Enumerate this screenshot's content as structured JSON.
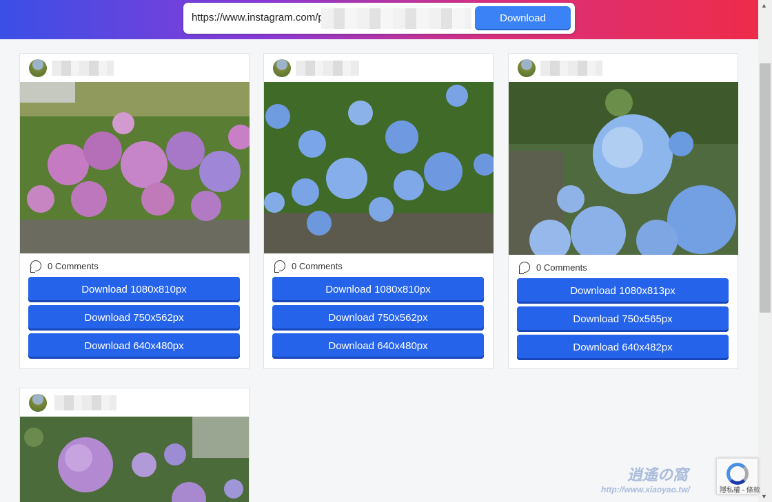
{
  "search": {
    "url_value": "https://www.instagram.com/p",
    "download_label": "Download"
  },
  "comments_label": "0 Comments",
  "cards": [
    {
      "downloads": [
        "Download 1080x810px",
        "Download 750x562px",
        "Download 640x480px"
      ]
    },
    {
      "downloads": [
        "Download 1080x810px",
        "Download 750x562px",
        "Download 640x480px"
      ]
    },
    {
      "downloads": [
        "Download 1080x813px",
        "Download 750x565px",
        "Download 640x482px"
      ]
    }
  ],
  "recaptcha": {
    "text": "隱私權 - 條款"
  },
  "watermark": {
    "line1": "http://www.xiaoyao.tw/",
    "line2": "逍遙の窩"
  },
  "colors": {
    "accent": "#2563eb",
    "header_gradient": [
      "#3a4fe6",
      "#8a3ad6",
      "#d8307e",
      "#ee2c4a"
    ]
  }
}
